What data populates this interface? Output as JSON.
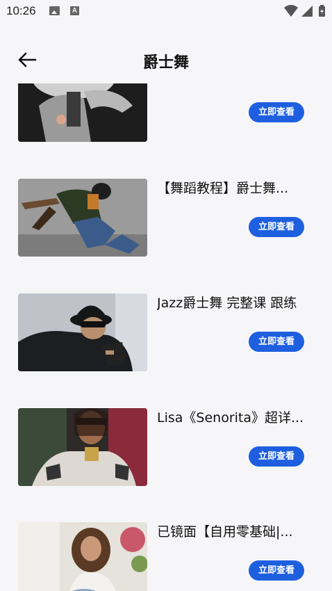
{
  "status_bar": {
    "time": "10:26",
    "a_icon_letter": "A"
  },
  "header": {
    "title": "爵士舞"
  },
  "list": {
    "items": [
      {
        "title": "",
        "button": "立即查看"
      },
      {
        "title": "【舞蹈教程】爵士舞...",
        "button": "立即查看"
      },
      {
        "title": "Jazz爵士舞 完整课 跟练",
        "button": "立即查看"
      },
      {
        "title": "Lisa《Senorita》超详...",
        "button": "立即查看"
      },
      {
        "title": "已镜面【自用零基础|...",
        "button": "立即查看"
      }
    ]
  }
}
